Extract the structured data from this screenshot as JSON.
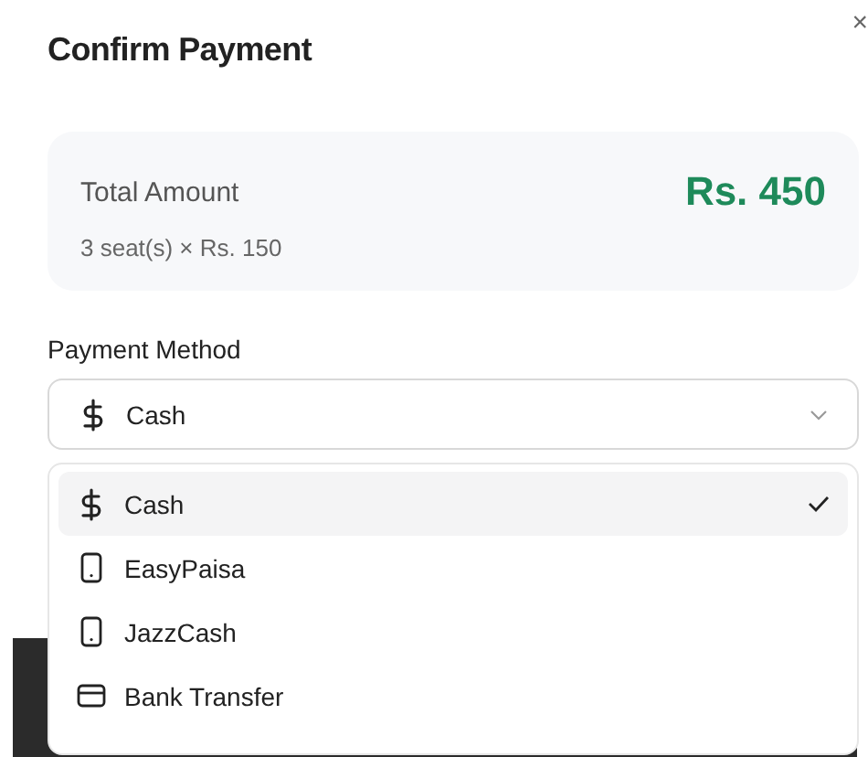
{
  "dialog": {
    "title": "Confirm Payment",
    "close": "×"
  },
  "summary": {
    "label": "Total Amount",
    "amount": "Rs. 450",
    "detail": "3 seat(s) × Rs. 150"
  },
  "payment_method": {
    "label": "Payment Method",
    "value": {
      "label": "Cash",
      "kind": "cash"
    },
    "expanded": true,
    "options": [
      {
        "label": "Cash",
        "kind": "cash",
        "selected": true
      },
      {
        "label": "EasyPaisa",
        "kind": "mobile",
        "selected": false
      },
      {
        "label": "JazzCash",
        "kind": "mobile",
        "selected": false
      },
      {
        "label": "Bank Transfer",
        "kind": "card",
        "selected": false
      }
    ]
  }
}
